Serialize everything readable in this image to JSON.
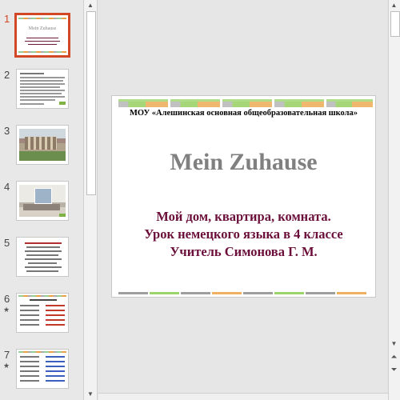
{
  "thumbnails": [
    {
      "number": "1",
      "active": true,
      "star": false,
      "title": "Mein Zuhause"
    },
    {
      "number": "2",
      "active": false,
      "star": false
    },
    {
      "number": "3",
      "active": false,
      "star": false
    },
    {
      "number": "4",
      "active": false,
      "star": false
    },
    {
      "number": "5",
      "active": false,
      "star": false
    },
    {
      "number": "6",
      "active": false,
      "star": true,
      "star_glyph": "★"
    },
    {
      "number": "7",
      "active": false,
      "star": true,
      "star_glyph": "★"
    }
  ],
  "slide": {
    "school": "МОУ «Алешинская основная общеобразовательная школа»",
    "title": "Mein Zuhause",
    "line1": "Мой дом, квартира, комната.",
    "line2": "Урок немецкого языка в 4 классе",
    "line3": "Учитель Симонова Г. М."
  },
  "scrollbar": {
    "up_glyph": "▲",
    "down_glyph": "▼",
    "prev_slide_glyph": "⏶",
    "next_slide_glyph": "⏷"
  },
  "colors": {
    "accent": "#d24726",
    "subtitle": "#6b0f3a",
    "title": "#808080"
  }
}
